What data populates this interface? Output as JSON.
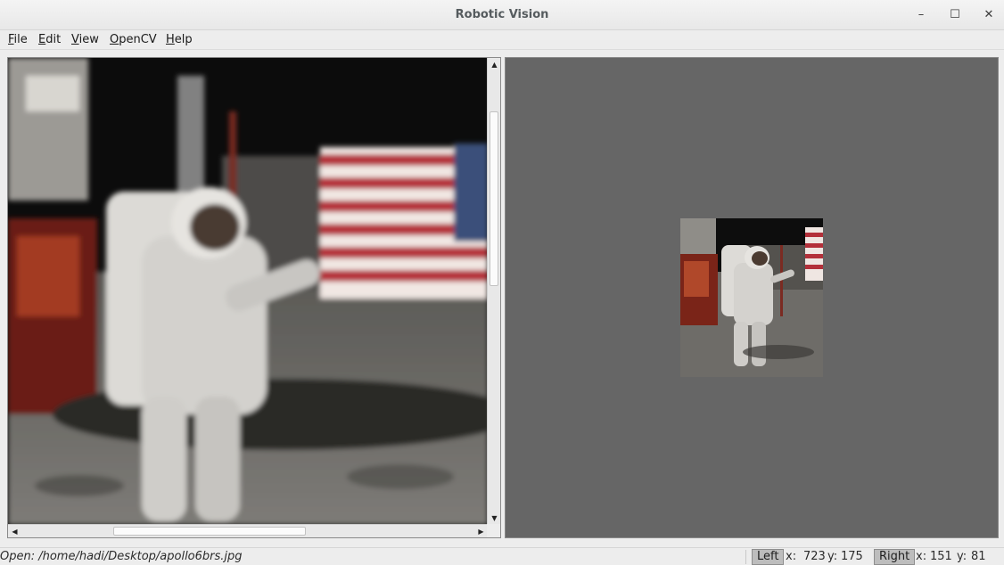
{
  "window": {
    "title": "Robotic Vision"
  },
  "window_controls": {
    "minimize": "–",
    "maximize": "☐",
    "close": "✕"
  },
  "menu": [
    {
      "prefix": "",
      "mnemonic": "F",
      "rest": "ile"
    },
    {
      "prefix": "",
      "mnemonic": "E",
      "rest": "dit"
    },
    {
      "prefix": "",
      "mnemonic": "V",
      "rest": "iew"
    },
    {
      "prefix": "",
      "mnemonic": "O",
      "rest": "penCV"
    },
    {
      "prefix": "",
      "mnemonic": "H",
      "rest": "elp"
    }
  ],
  "scroll": {
    "up": "▲",
    "down": "▼",
    "left": "◀",
    "right": "▶"
  },
  "status": {
    "message": "Open: /home/hadi/Desktop/apollo6brs.jpg",
    "left_label": "Left",
    "left_x_label": "x:",
    "left_x": "723",
    "left_y_label": "y:",
    "left_y": "175",
    "right_label": "Right",
    "right_x_label": "x:",
    "right_x": "151",
    "right_y_label": "y:",
    "right_y": "81"
  }
}
